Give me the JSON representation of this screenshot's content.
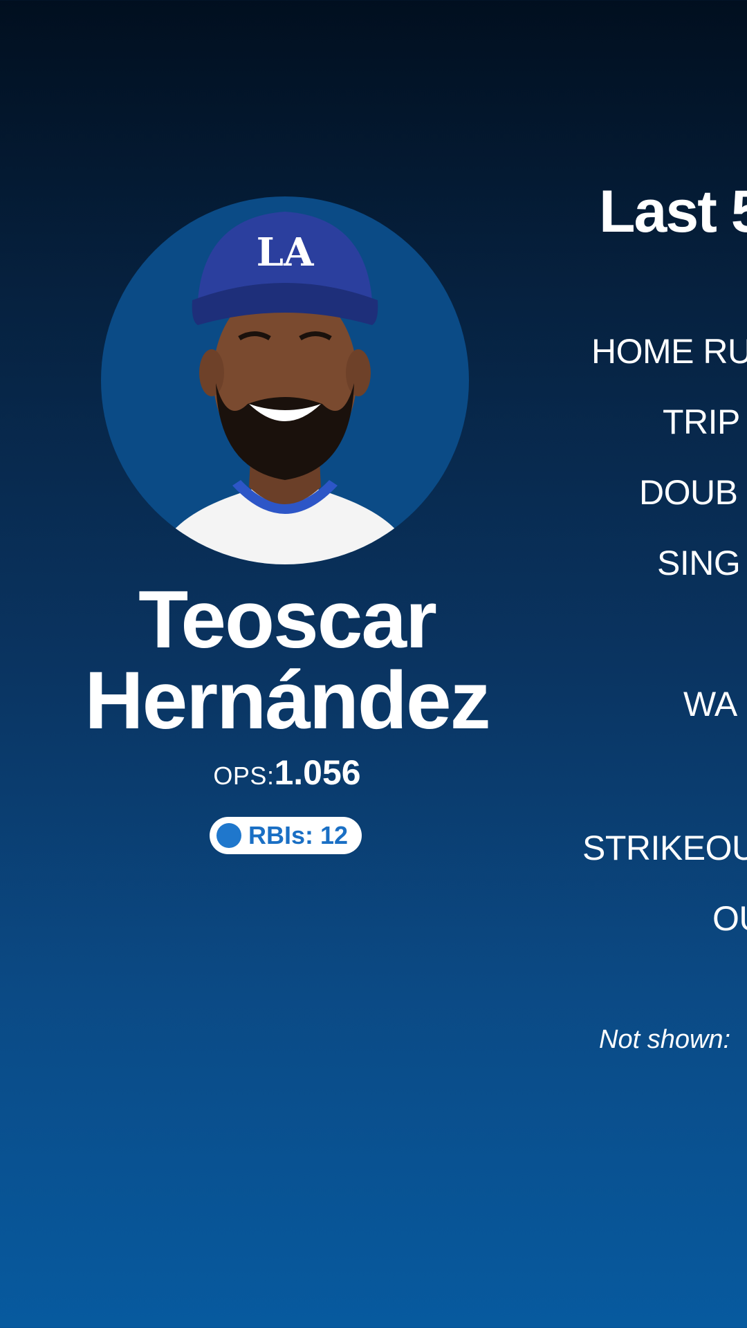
{
  "player": {
    "first_name": "Teoscar",
    "last_name": "Hernández",
    "ops_label": "OPS:",
    "ops_value": "1.056",
    "rbi_label": "RBIs:",
    "rbi_value": "12",
    "photo_icon": "player-headshot",
    "cap_logo_text": "LA"
  },
  "panel": {
    "title": "Last 5",
    "stats": [
      "HOME RU",
      "TRIP",
      "DOUB",
      "SING",
      "WA",
      "STRIKEOU",
      "OU"
    ],
    "note": "Not shown:"
  },
  "colors": {
    "background_top": "#010f1f",
    "background_bottom": "#075a9f",
    "avatar_circle": "#0b4b86",
    "cap_blue": "#2b3f9e",
    "pill_text": "#1a6fc4",
    "pill_dot": "#1f77cc"
  }
}
